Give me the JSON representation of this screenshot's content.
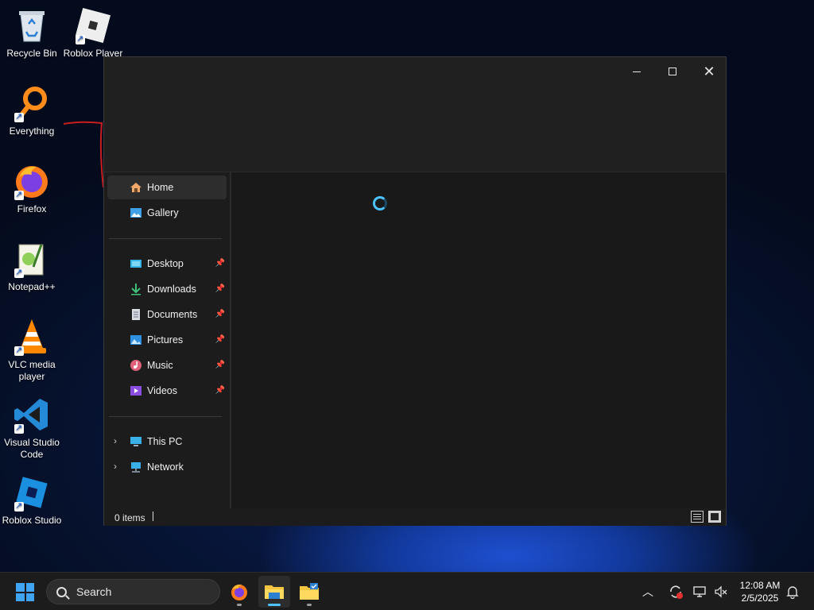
{
  "desktop": {
    "icons": [
      {
        "label": "Recycle Bin",
        "icon": "recycle-bin-icon"
      },
      {
        "label": "Roblox Player",
        "icon": "roblox-player-icon"
      },
      {
        "label": "Everything",
        "icon": "everything-search-icon"
      },
      {
        "label": "Firefox",
        "icon": "firefox-icon"
      },
      {
        "label": "Notepad++",
        "icon": "notepad-plus-plus-icon"
      },
      {
        "label": "VLC media player",
        "icon": "vlc-icon"
      },
      {
        "label": "Visual Studio Code",
        "icon": "vscode-icon"
      },
      {
        "label": "Roblox Studio",
        "icon": "roblox-studio-icon"
      }
    ]
  },
  "explorer": {
    "nav": {
      "home": "Home",
      "gallery": "Gallery",
      "quick_access": [
        {
          "label": "Desktop",
          "icon": "desktop-folder-icon"
        },
        {
          "label": "Downloads",
          "icon": "downloads-icon"
        },
        {
          "label": "Documents",
          "icon": "documents-icon"
        },
        {
          "label": "Pictures",
          "icon": "pictures-icon"
        },
        {
          "label": "Music",
          "icon": "music-icon"
        },
        {
          "label": "Videos",
          "icon": "videos-icon"
        }
      ],
      "this_pc": "This PC",
      "network": "Network"
    },
    "status": {
      "item_count": "0 items"
    },
    "loading": true
  },
  "taskbar": {
    "search_placeholder": "Search",
    "apps": [
      {
        "name": "Firefox",
        "icon": "firefox-icon",
        "active": false
      },
      {
        "name": "File Explorer",
        "icon": "file-explorer-icon",
        "active": true
      },
      {
        "name": "File Explorer",
        "icon": "folder-check-icon",
        "active": false
      }
    ],
    "clock": {
      "time": "12:08 AM",
      "date": "2/5/2025"
    }
  },
  "colors": {
    "accent": "#4cc2ff",
    "window_bg": "#1c1c1c",
    "taskbar_bg": "#1c1c1c"
  }
}
